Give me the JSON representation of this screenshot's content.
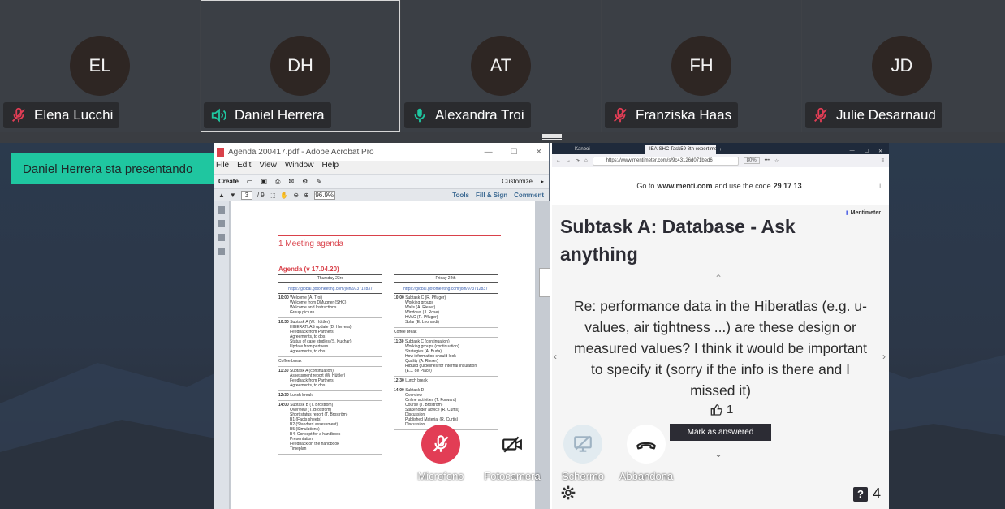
{
  "participants": [
    {
      "initials": "EL",
      "name": "Elena Lucchi",
      "mic": "muted"
    },
    {
      "initials": "DH",
      "name": "Daniel Herrera",
      "mic": "speaking"
    },
    {
      "initials": "AT",
      "name": "Alexandra Troi",
      "mic": "on"
    },
    {
      "initials": "FH",
      "name": "Franziska Haas",
      "mic": "muted"
    },
    {
      "initials": "JD",
      "name": "Julie Desarnaud",
      "mic": "muted"
    }
  ],
  "presenter_badge": "Daniel Herrera sta presentando",
  "colors": {
    "accent": "#1fc6a0",
    "muted_red": "#e23d55",
    "mic_green": "#1fc6a0"
  },
  "acrobat": {
    "title": "Agenda 200417.pdf - Adobe Acrobat Pro",
    "menu": [
      "File",
      "Edit",
      "View",
      "Window",
      "Help"
    ],
    "toolbar": {
      "create": "Create",
      "customize": "Customize"
    },
    "nav": {
      "page": "3",
      "of": "/ 9",
      "zoom": "96.9%",
      "tools": "Tools",
      "fill_sign": "Fill & Sign",
      "comment": "Comment"
    },
    "page": {
      "heading": "1   Meeting agenda",
      "subheading": "Agenda (v 17.04.20)",
      "thursday": {
        "day": "Thursday 23rd",
        "link": "https://global.gotomeeting.com/join/973712837",
        "rows": [
          {
            "time": "10:00",
            "title": "Welcome (A. Troi)",
            "items": [
              "Welcome from DMugner (SHC)",
              "Welcome and Instructions",
              "Group picture"
            ]
          },
          {
            "time": "10:30",
            "title": "Subtask A (W. Hüttler)",
            "items": [
              "HIBERATLAS update (D. Herrera)",
              "Feedback from Partners",
              "Agreements, to dos",
              "Status of case studies (S. Kuchar)",
              "Update from partners",
              "Agreements, to dos"
            ]
          },
          {
            "time": "",
            "title": "Coffee break",
            "items": []
          },
          {
            "time": "11:30",
            "title": "Subtask A (continuation)",
            "items": [
              "Assessment report (W. Hüttler)",
              "Feedback from Partners",
              "Agreements, to dos"
            ]
          },
          {
            "time": "12:30",
            "title": "Lunch break",
            "items": []
          },
          {
            "time": "14:00",
            "title": "Subtask B (T. Broström)",
            "items": [
              "Overview (T. Broström)",
              "Short status report (T. Broström)",
              "B1 (Facts sheets)",
              "B2 (Standard assessment)",
              "B5 (Simulations)",
              "B4: Concept for a handbook",
              "Presentation",
              "Feedback on the handbook",
              "Timeplan"
            ]
          }
        ]
      },
      "friday": {
        "day": "Friday 24th",
        "link": "https://global.gotomeeting.com/join/973712837",
        "rows": [
          {
            "time": "10:00",
            "title": "Subtask C (R. Pfluger)",
            "items": [
              "Working groups",
              "Walls (A. Rieser)",
              "Windows (J. Rose)",
              "HVAC (R. Pfluger)",
              "Solar (E. Leonardi)"
            ]
          },
          {
            "time": "",
            "title": "Coffee break",
            "items": []
          },
          {
            "time": "11:30",
            "title": "Subtask C (continuation)",
            "items": [
              "Working groups (continuation)",
              "Strategies (A. Buda)",
              "How information should look",
              "Quality (A. Rieser)",
              "RIBuild guidelines for Internal Insulation",
              "(E.J. de Place)"
            ]
          },
          {
            "time": "12:30",
            "title": "Lunch break",
            "items": []
          },
          {
            "time": "14:00",
            "title": "Subtask D",
            "items": [
              "Overview",
              "Online activities (T. Forward)",
              "Course (T. Broström)",
              "Stakeholder advice (R. Curtis)",
              "Discussion",
              "Published Material (R. Curtis)",
              "Discussion"
            ]
          }
        ]
      }
    }
  },
  "browser": {
    "tabs": [
      "Kanboi",
      "IEA-SHC Task59 8th expert mee"
    ],
    "url": "https://www.mentimeter.com/s/9c43126d071bed6",
    "zoom": "80%",
    "menti": {
      "top_prefix": "Go to",
      "site": "www.menti.com",
      "top_mid": "and use the code",
      "code": "29 17 13",
      "logo": "Mentimeter",
      "title": "Subtask A: Database - Ask anything",
      "question": "Re: performance data in the Hiberatlas (e.g. u-values, air tightness ...) are these design or measured values? I think it would be important to specify it (sorry if the info is there and I missed it)",
      "likes": "1",
      "mark_button": "Mark as answered",
      "question_count": "4"
    }
  },
  "controls": [
    {
      "label": "Microfono",
      "style": "red"
    },
    {
      "label": "Fotocamera",
      "style": "white"
    },
    {
      "label": "Schermo",
      "style": "disabled"
    },
    {
      "label": "Abbandona",
      "style": "white"
    }
  ]
}
